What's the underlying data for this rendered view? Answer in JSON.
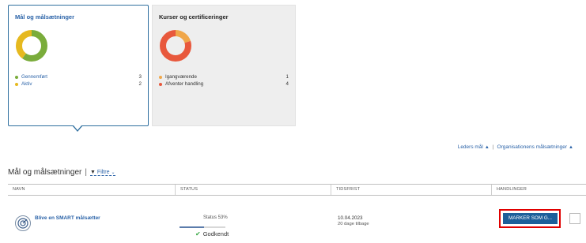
{
  "cards": [
    {
      "title": "Mål og målsætninger",
      "selected": true,
      "donut": {
        "segments": [
          {
            "color": "#7aac3b",
            "value": 3
          },
          {
            "color": "#e6b91f",
            "value": 2
          }
        ]
      },
      "legend": [
        {
          "label": "Gennemført",
          "count": "3",
          "color": "#7aac3b"
        },
        {
          "label": "Aktiv",
          "count": "2",
          "color": "#e6b91f"
        }
      ]
    },
    {
      "title": "Kurser og certificeringer",
      "selected": false,
      "donut": {
        "segments": [
          {
            "color": "#f0a74a",
            "value": 1
          },
          {
            "color": "#e8583c",
            "value": 4
          }
        ]
      },
      "legend": [
        {
          "label": "Igangværende",
          "count": "1",
          "color": "#f0a74a"
        },
        {
          "label": "Afventer handling",
          "count": "4",
          "color": "#e8583c"
        }
      ]
    }
  ],
  "links": {
    "leaders_goals": "Leders mål",
    "org_goals": "Organisationens målsætninger"
  },
  "section": {
    "title": "Mål og målsætninger",
    "filter": "Filtre"
  },
  "table": {
    "columns": [
      "Navn",
      "Status",
      "Tidsfrist",
      "Handlinger"
    ],
    "rows": [
      {
        "name": "Blive en SMART målsætter",
        "status": "Status 53%",
        "progress": 0.53,
        "deadline": "10.04.2023",
        "days_left": "20 dage tilbage",
        "action": "MARKER SOM G...",
        "approval": "Godkendt"
      }
    ]
  },
  "icons": {
    "filter": "filter-icon",
    "check": "check-icon",
    "goal": "target-icon",
    "chevron": "chevron-up-icon"
  }
}
